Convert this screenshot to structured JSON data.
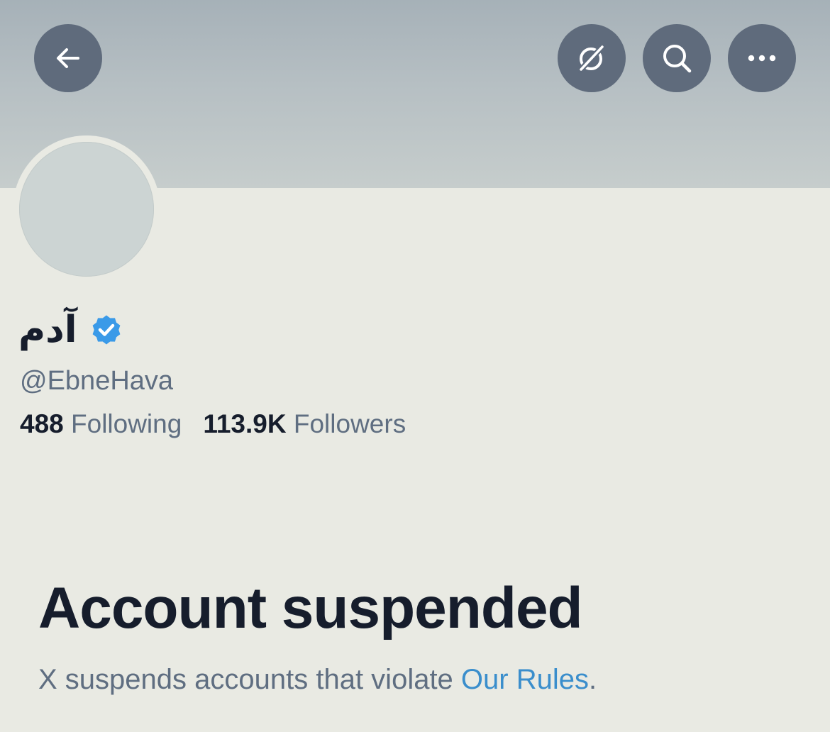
{
  "header": {
    "buttons": {
      "back": "back-arrow-icon",
      "grok": "grok-slash-icon",
      "search": "search-icon",
      "more": "more-dots-icon"
    }
  },
  "profile": {
    "display_name": "آدم",
    "verified": true,
    "handle": "@EbneHava",
    "following_count": "488",
    "following_label": "Following",
    "followers_count": "113.9K",
    "followers_label": "Followers"
  },
  "suspension": {
    "title": "Account suspended",
    "message_prefix": "X suspends accounts that violate ",
    "rules_link": "Our Rules",
    "message_suffix": "."
  },
  "colors": {
    "background": "#e9eae3",
    "banner": "#b6bfc3",
    "button_bg": "#5f6b7c",
    "text_primary": "#161d2c",
    "text_secondary": "#5f6e81",
    "link": "#3a8ecc",
    "verified_badge": "#3a9ae8"
  }
}
